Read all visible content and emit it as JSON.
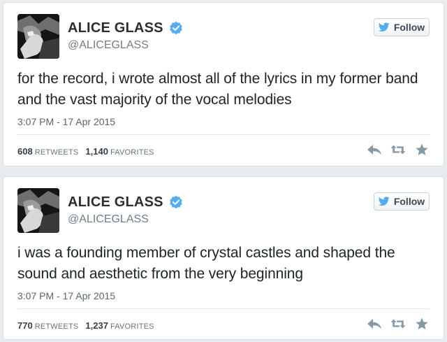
{
  "colors": {
    "page_background": "#e9ecee",
    "card_background": "#ffffff",
    "verified_badge": "#55acee",
    "twitter_bird": "#55acee",
    "action_icons": "#8899a6"
  },
  "icons": {
    "verified": "verified-badge-icon",
    "follow": "twitter-bird-icon",
    "reply": "reply-icon",
    "retweet": "retweet-icon",
    "favorite": "star-icon"
  },
  "tweets": [
    {
      "display_name": "ALICE GLASS",
      "handle": "@ALICEGLASS",
      "follow_label": "Follow",
      "text": "for the record, i wrote almost all of the lyrics in my former band and the vast majority of the vocal melodies",
      "timestamp": "3:07 PM - 17 Apr 2015",
      "retweets": "608",
      "retweets_label": "RETWEETS",
      "favorites": "1,140",
      "favorites_label": "FAVORITES"
    },
    {
      "display_name": "ALICE GLASS",
      "handle": "@ALICEGLASS",
      "follow_label": "Follow",
      "text": "i was a founding member of crystal castles and shaped the sound and aesthetic from the very beginning",
      "timestamp": "3:07 PM - 17 Apr 2015",
      "retweets": "770",
      "retweets_label": "RETWEETS",
      "favorites": "1,237",
      "favorites_label": "FAVORITES"
    }
  ]
}
